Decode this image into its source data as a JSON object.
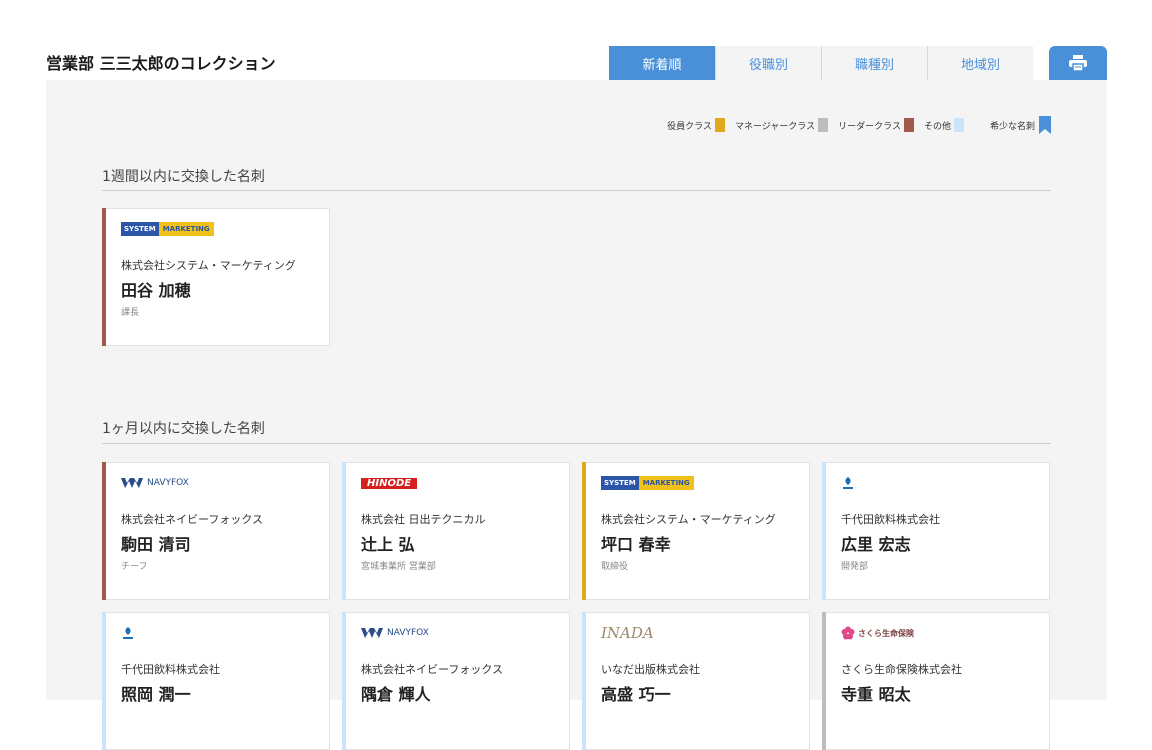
{
  "page_title": "営業部 三三太郎のコレクション",
  "tabs": [
    {
      "label": "新着順",
      "active": true
    },
    {
      "label": "役職別",
      "active": false
    },
    {
      "label": "職種別",
      "active": false
    },
    {
      "label": "地域別",
      "active": false
    }
  ],
  "print_icon": "printer-icon",
  "colors": {
    "accent": "#4a90d9",
    "executive": "#e0a81d",
    "manager": "#bdbdbd",
    "leader": "#a0594a",
    "other": "#cce4fb",
    "rare": "#4a90d9"
  },
  "legend": {
    "executive": "役員クラス",
    "manager": "マネージャークラス",
    "leader": "リーダークラス",
    "other": "その他",
    "rare": "希少な名刺"
  },
  "sections": [
    {
      "title": "1週間以内に交換した名刺",
      "cards": [
        {
          "logo": "SYSTEM MARKETING",
          "logo_b": "MARKETING",
          "logo_a": "SYSTEM",
          "company": "株式会社システム・マーケティング",
          "name": "田谷 加穂",
          "title": "課長",
          "class": "leader"
        }
      ]
    },
    {
      "title": "1ヶ月以内に交換した名刺",
      "cards": [
        {
          "logo": "NAVYFOX",
          "company": "株式会社ネイビーフォックス",
          "name": "駒田 清司",
          "title": "チーフ",
          "class": "leader"
        },
        {
          "logo": "HINODE",
          "company": "株式会社 日出テクニカル",
          "name": "辻上 弘",
          "title": "宮城事業所 営業部",
          "class": "other"
        },
        {
          "logo_a": "SYSTEM",
          "logo_b": "MARKETING",
          "company": "株式会社システム・マーケティング",
          "name": "坪口 春幸",
          "title": "取締役",
          "class": "executive"
        },
        {
          "logo": "chiyoda-logo-icon",
          "company": "千代田飲料株式会社",
          "name": "広里 宏志",
          "title": "開発部",
          "class": "other"
        },
        {
          "logo": "chiyoda-logo-icon",
          "company": "千代田飲料株式会社",
          "name": "照岡 潤一",
          "title": "",
          "class": "other"
        },
        {
          "logo": "NAVYFOX",
          "company": "株式会社ネイビーフォックス",
          "name": "隅倉 輝人",
          "title": "",
          "class": "other"
        },
        {
          "logo": "INADA",
          "company": "いなだ出版株式会社",
          "name": "高盛 巧一",
          "title": "",
          "class": "other"
        },
        {
          "logo": "さくら生命保険",
          "company": "さくら生命保険株式会社",
          "name": "寺重 昭太",
          "title": "",
          "class": "manager"
        }
      ]
    }
  ]
}
